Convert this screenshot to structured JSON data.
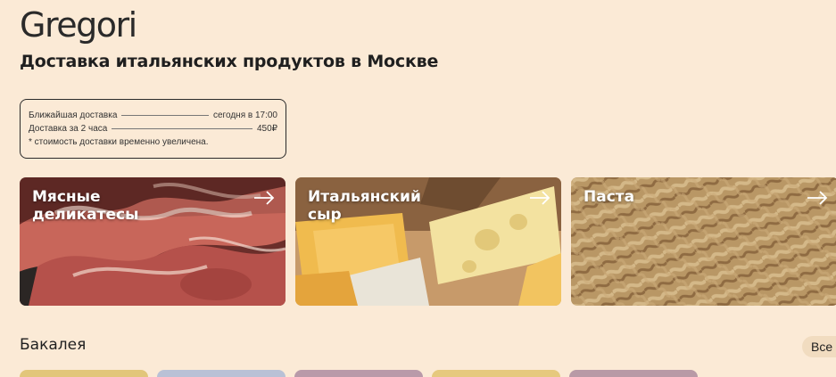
{
  "brand": {
    "logo": "Gregori",
    "tagline": "Доставка итальянских продуктов в Москве"
  },
  "delivery": {
    "rows": [
      {
        "label": "Ближайшая доставка",
        "value": "сегодня в 17:00"
      },
      {
        "label": "Доставка за 2 часа",
        "value": "450₽"
      }
    ],
    "note": "* стоимость доставки временно увеличена."
  },
  "categories": [
    {
      "title": "Мясные\nделикатесы",
      "image": "prosciutto"
    },
    {
      "title": "Итальянский\nсыр",
      "image": "cheese"
    },
    {
      "title": "Паста",
      "image": "fusilli"
    }
  ],
  "section": {
    "title": "Бакалея",
    "all_label": "Все"
  },
  "colors": {
    "background": "#fbead6",
    "tiles": [
      "#e2c67a",
      "#b9c1d6",
      "#b99aa9",
      "#e6c97e",
      "#b89aa6"
    ]
  }
}
